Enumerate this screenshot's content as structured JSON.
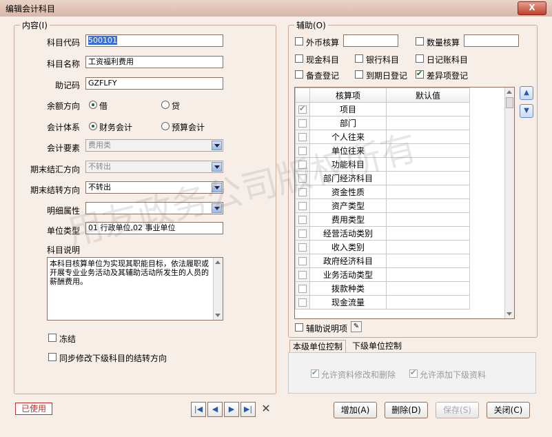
{
  "window": {
    "title": "编辑会计科目",
    "close_label": "X"
  },
  "content_group": {
    "title": "内容(I)"
  },
  "fields": {
    "code": {
      "label": "科目代码",
      "value": "500101"
    },
    "name": {
      "label": "科目名称",
      "value": "工资福利费用"
    },
    "mnemonic": {
      "label": "助记码",
      "value": "GZFLFY"
    },
    "balance_direction": {
      "label": "余额方向",
      "options": [
        "借",
        "贷"
      ],
      "selected": "借"
    },
    "accounting_system": {
      "label": "会计体系",
      "options": [
        "财务会计",
        "预算会计"
      ],
      "selected": "财务会计"
    },
    "element": {
      "label": "会计要素",
      "value": "费用类"
    },
    "period_end_summary": {
      "label": "期末结汇方向",
      "value": "不转出"
    },
    "period_end_transfer": {
      "label": "期末结转方向",
      "value": "不转出"
    },
    "detail_attr": {
      "label": "明细属性",
      "value": ""
    },
    "unit_type": {
      "label": "单位类型",
      "value": "01 行政单位,02 事业单位"
    },
    "description": {
      "label": "科目说明",
      "value": "本科目核算单位为实现其职能目标，依法履职或开展专业业务活动及其辅助活动所发生的人员的薪酬费用。"
    },
    "freeze": {
      "label": "冻结",
      "checked": false
    },
    "sync_subordinate": {
      "label": "同步修改下级科目的结转方向",
      "checked": false
    }
  },
  "aux_group": {
    "title": "辅助(O)",
    "checks": [
      {
        "label": "外币核算",
        "checked": false
      },
      {
        "label": "数量核算",
        "checked": false
      },
      {
        "label": "现金科目",
        "checked": false
      },
      {
        "label": "银行科目",
        "checked": false
      },
      {
        "label": "日记账科目",
        "checked": false
      },
      {
        "label": "备查登记",
        "checked": false
      },
      {
        "label": "到期日登记",
        "checked": false
      },
      {
        "label": "差异项登记",
        "checked": true
      }
    ],
    "grid": {
      "headers": [
        "核算项",
        "默认值"
      ],
      "rows": [
        {
          "item": "项目",
          "checked": true
        },
        {
          "item": "部门",
          "checked": false
        },
        {
          "item": "个人往来",
          "checked": false
        },
        {
          "item": "单位往来",
          "checked": false
        },
        {
          "item": "功能科目",
          "checked": false
        },
        {
          "item": "部门经济科目",
          "checked": false
        },
        {
          "item": "资金性质",
          "checked": false
        },
        {
          "item": "资产类型",
          "checked": false
        },
        {
          "item": "费用类型",
          "checked": false
        },
        {
          "item": "经营活动类别",
          "checked": false
        },
        {
          "item": "收入类别",
          "checked": false
        },
        {
          "item": "政府经济科目",
          "checked": false
        },
        {
          "item": "业务活动类型",
          "checked": false
        },
        {
          "item": "拨款种类",
          "checked": false
        },
        {
          "item": "现金流量",
          "checked": false
        }
      ]
    },
    "aux_desc": {
      "label": "辅助说明项",
      "checked": false
    }
  },
  "tabs": [
    "本级单位控制",
    "下级单位控制"
  ],
  "control": {
    "allow_modify": {
      "label": "允许资料修改和删除",
      "checked": true
    },
    "allow_add": {
      "label": "允许添加下级资料",
      "checked": true
    }
  },
  "status_badge": "已使用",
  "buttons": {
    "add": "增加(A)",
    "delete": "删除(D)",
    "save": "保存(S)",
    "close": "关闭(C)"
  },
  "watermark": "用友政务公司版权所有"
}
